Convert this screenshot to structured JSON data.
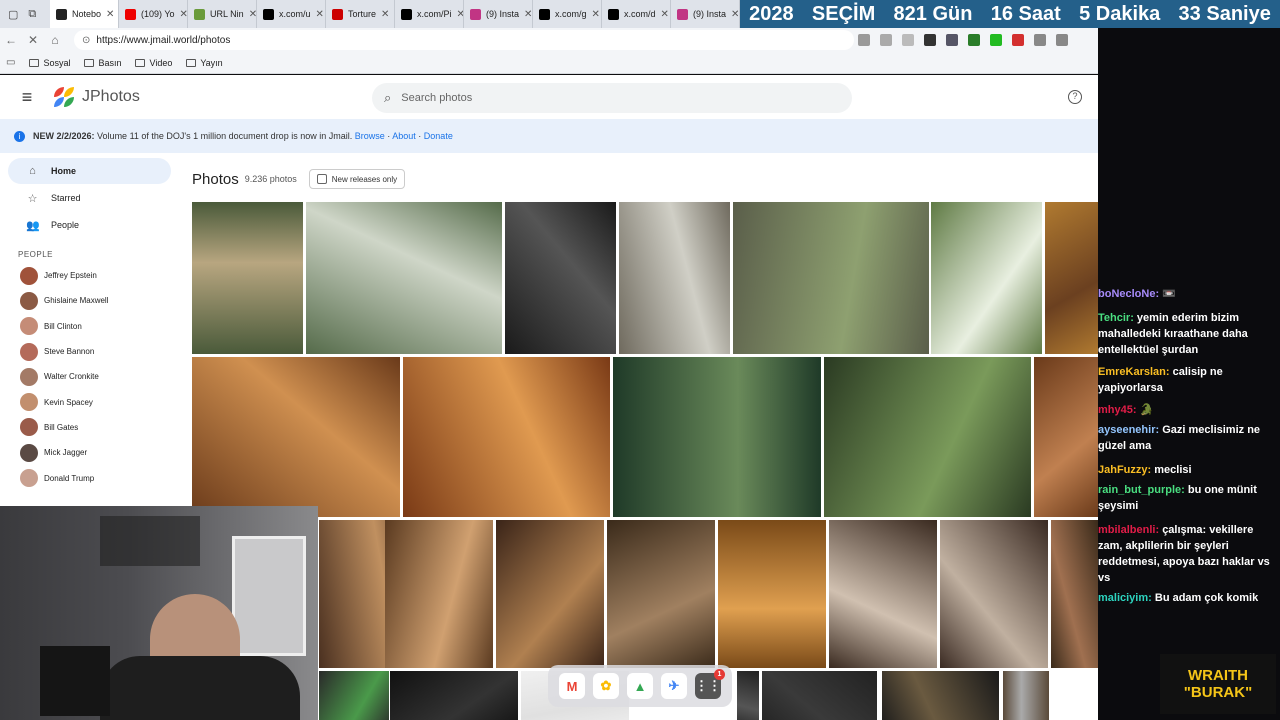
{
  "browser": {
    "tabs": [
      {
        "label": "Notebo",
        "fav_color": "#222"
      },
      {
        "label": "(109) Yo",
        "fav_color": "#e00"
      },
      {
        "label": "URL Nin",
        "fav_color": "#6a9b3b"
      },
      {
        "label": "x.com/u",
        "fav_color": "#000"
      },
      {
        "label": "Torture",
        "fav_color": "#c00"
      },
      {
        "label": "x.com/Pi",
        "fav_color": "#000"
      },
      {
        "label": "(9) Insta",
        "fav_color": "#c13584"
      },
      {
        "label": "x.com/g",
        "fav_color": "#000"
      },
      {
        "label": "x.com/d",
        "fav_color": "#000"
      },
      {
        "label": "(9) Insta",
        "fav_color": "#c13584"
      }
    ],
    "url": "https://www.jmail.world/photos",
    "bookmarks": [
      "Sosyal",
      "Basın",
      "Video",
      "Yayın"
    ]
  },
  "countdown": {
    "year": "2028",
    "title": "SEÇİM",
    "days": "821 Gün",
    "hours": "16 Saat",
    "minutes": "5 Dakika",
    "seconds": "33 Saniye"
  },
  "app": {
    "name": "JPhotos",
    "search_placeholder": "Search photos",
    "banner": {
      "bold": "NEW 2/2/2026:",
      "text": "Volume 11 of the DOJ's 1 million document drop is now in Jmail.",
      "links": [
        "Browse",
        "About",
        "Donate"
      ]
    },
    "nav": [
      {
        "label": "Home",
        "icon": "home-icon",
        "glyph": "⌂"
      },
      {
        "label": "Starred",
        "icon": "star-icon",
        "glyph": "☆"
      },
      {
        "label": "People",
        "icon": "people-icon",
        "glyph": "👥"
      }
    ],
    "people_header": "PEOPLE",
    "people": [
      "Jeffrey Epstein",
      "Ghislaine Maxwell",
      "Bill Clinton",
      "Steve Bannon",
      "Walter Cronkite",
      "Kevin Spacey",
      "Bill Gates",
      "Mick Jagger",
      "Donald Trump"
    ],
    "photos_title": "Photos",
    "photos_count": "9.236 photos",
    "filter_label": "New releases only"
  },
  "chat": [
    {
      "user": "boNecloNe:",
      "color": "#a78bfa",
      "msg": "📼"
    },
    {
      "user": "Tehcir:",
      "color": "#4ade80",
      "msg": "yemin ederim bizim mahalledeki kıraathane daha entellektüel şurdan"
    },
    {
      "user": "EmreKarslan:",
      "color": "#fbbf24",
      "msg": "calisip ne yapiyorlarsa"
    },
    {
      "user": "mhy45:",
      "color": "#e11d48",
      "msg": "🐊"
    },
    {
      "user": "ayseenehir:",
      "color": "#93c5fd",
      "msg": "Gazi meclisimiz ne güzel ama"
    },
    {
      "user": "JahFuzzy:",
      "color": "#fbbf24",
      "msg": "meclisi"
    },
    {
      "user": "rain_but_purple:",
      "color": "#4ade80",
      "msg": "bu one münit şeysimi"
    },
    {
      "user": "mbilalbenli:",
      "color": "#e11d48",
      "msg": "çalışma: vekillere zam, akplilerin bir şeyleri reddetmesi, apoya bazı haklar vs vs"
    },
    {
      "user": "maliciyim:",
      "color": "#2dd4bf",
      "msg": "Bu adam çok komik"
    }
  ],
  "sponsor": {
    "line1": "WRAITH",
    "line2": "\"BURAK\""
  },
  "dock": {
    "badge": "1"
  }
}
